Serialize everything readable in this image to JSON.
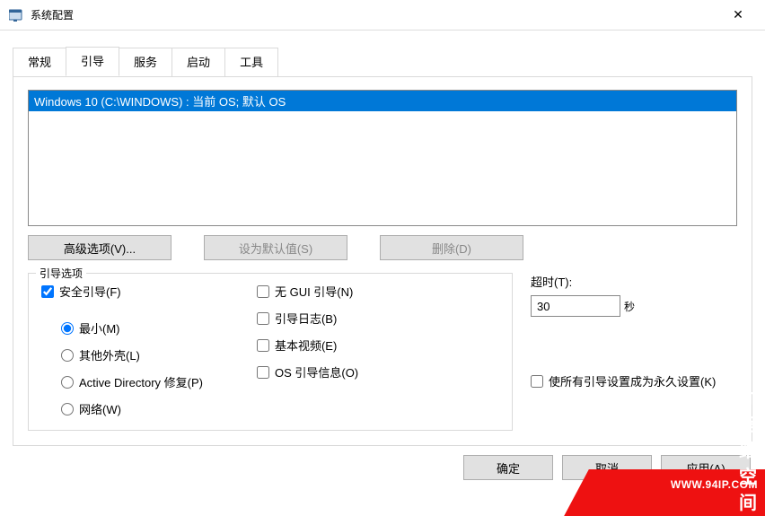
{
  "window": {
    "title": "系统配置",
    "close_glyph": "✕"
  },
  "tabs": {
    "general": "常规",
    "boot": "引导",
    "services": "服务",
    "startup": "启动",
    "tools": "工具"
  },
  "bootlist": {
    "item0": "Windows 10 (C:\\WINDOWS) : 当前 OS; 默认 OS"
  },
  "buttons": {
    "advanced": "高级选项(V)...",
    "set_default": "设为默认值(S)",
    "delete": "删除(D)",
    "ok": "确定",
    "cancel": "取消",
    "apply": "应用(A)"
  },
  "boot_options": {
    "legend": "引导选项",
    "safeboot": "安全引导(F)",
    "minimal": "最小(M)",
    "altshell": "其他外壳(L)",
    "ad_repair": "Active Directory 修复(P)",
    "network": "网络(W)",
    "nogui": "无 GUI 引导(N)",
    "bootlog": "引导日志(B)",
    "basevideo": "基本视频(E)",
    "osbootinfo": "OS 引导信息(O)"
  },
  "timeout": {
    "label": "超时(T):",
    "value": "30",
    "unit": "秒"
  },
  "permanent": {
    "label": "使所有引导设置成为永久设置(K)"
  },
  "watermark": {
    "url": "WWW.94IP.COM",
    "text": "IT运维空间"
  }
}
